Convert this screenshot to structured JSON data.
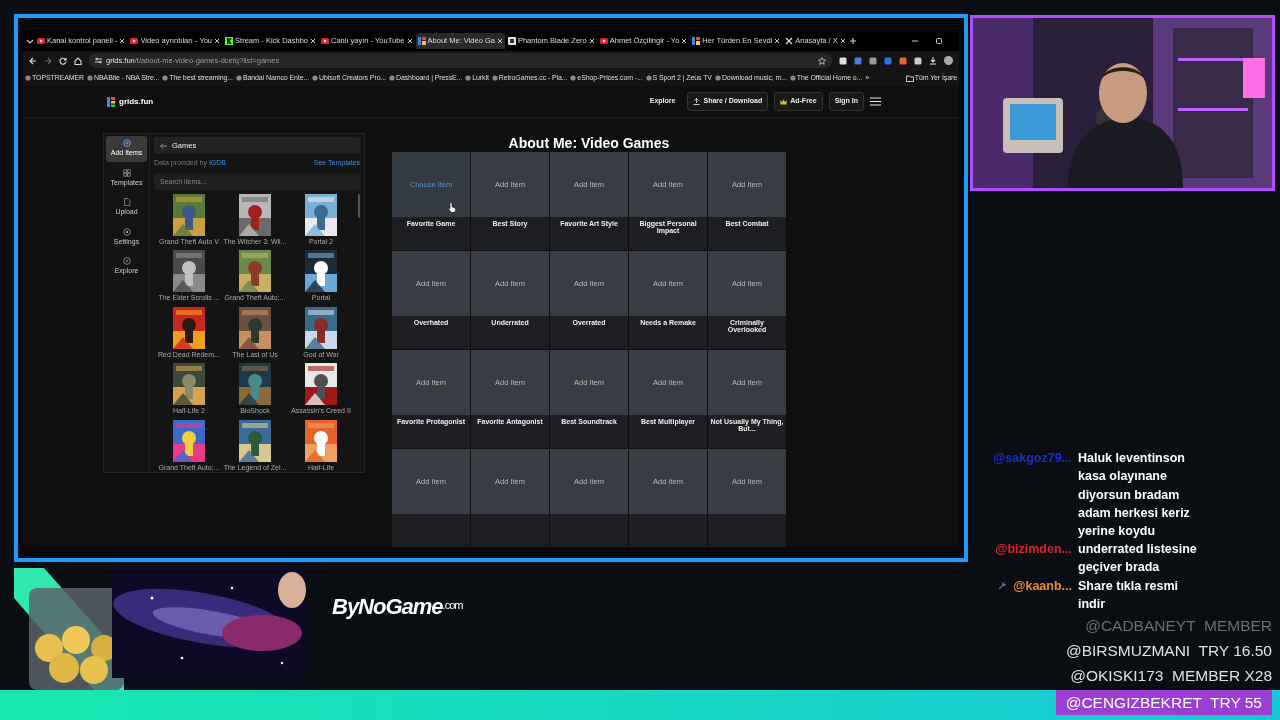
{
  "browser": {
    "tabs": [
      {
        "kind": "video",
        "title": "Kanal kontrol paneli -",
        "selected": false
      },
      {
        "kind": "video",
        "title": "Video ayrıntıları - You",
        "selected": false
      },
      {
        "kind": "stream",
        "title": "Stream - Kick Dashbo",
        "selected": false
      },
      {
        "kind": "video",
        "title": "Canlı yayın - YouTube",
        "selected": false
      },
      {
        "kind": "grid",
        "title": "About Me: Video Ga",
        "selected": true
      },
      {
        "kind": "store",
        "title": "Phantom Blade Zero",
        "selected": false
      },
      {
        "kind": "video",
        "title": "Ahmet Özçilingir - Yo",
        "selected": false
      },
      {
        "kind": "grid",
        "title": "Her Türden En Sevdi",
        "selected": false
      },
      {
        "kind": "social",
        "title": "Anasayfa / X",
        "selected": false
      }
    ],
    "address": {
      "host": "grids.fun",
      "path": "/t/about-me-video-games-dcefq?list=games"
    },
    "bookmarks": [
      "TOPSTREAMER",
      "NBABite - NBA Stre...",
      "The best streaming...",
      "Bandai Namco Ente...",
      "Ubisoft Creators Pro...",
      "Dashboard | PressE...",
      "Lurkit",
      "RetroGames.cc - Pla...",
      "eShop-Prices.com -...",
      "S Sport 2 | Zeus TV",
      "Download music, m...",
      "The Official Home o..."
    ],
    "bookmarks_more": "»",
    "bookmarks_folder": "Tüm Yer İşare"
  },
  "site": {
    "logo": "grids.fun",
    "nav": [
      {
        "kind": "link",
        "label": "Explore"
      },
      {
        "kind": "share",
        "label": "Share / Download"
      },
      {
        "kind": "premium",
        "label": "Ad-Free"
      },
      {
        "kind": "button",
        "label": "Sign In"
      }
    ],
    "sidebar": [
      {
        "kind": "add",
        "label": "Add Items",
        "selected": true
      },
      {
        "kind": "templates",
        "label": "Templates",
        "selected": false
      },
      {
        "kind": "upload",
        "label": "Upload",
        "selected": false
      },
      {
        "kind": "settings",
        "label": "Settings",
        "selected": false
      },
      {
        "kind": "explore",
        "label": "Explore",
        "selected": false
      }
    ],
    "panel": {
      "title": "Games",
      "credit": "Data provided by ",
      "credit_link": "IGDB",
      "templates_link": "See Templates",
      "search": {
        "placeholder": "Search items..."
      },
      "games": [
        "Grand Theft Auto V",
        "The Witcher 3: Wil...",
        "Portal 2",
        "The Elder Scrolls ...",
        "Grand Theft Auto:...",
        "Portal",
        "Red Dead Redem...",
        "The Last of Us",
        "God of War",
        "Half-Life 2",
        "BioShock",
        "Assassin's Creed II",
        "Grand Theft Auto:...",
        "The Legend of Zel...",
        "Half-Life"
      ]
    },
    "grid": {
      "title": "About Me: Video Games",
      "cells": [
        {
          "prompt": "Choose Item",
          "label": "Favorite Game",
          "hovered": true
        },
        {
          "prompt": "Add Item",
          "label": "Best Story",
          "hovered": false
        },
        {
          "prompt": "Add Item",
          "label": "Favorite Art Style",
          "hovered": false
        },
        {
          "prompt": "Add Item",
          "label": "Biggest Personal Impact",
          "hovered": false
        },
        {
          "prompt": "Add Item",
          "label": "Best Combat",
          "hovered": false
        },
        {
          "prompt": "Add Item",
          "label": "Overhated",
          "hovered": false
        },
        {
          "prompt": "Add Item",
          "label": "Underrated",
          "hovered": false
        },
        {
          "prompt": "Add Item",
          "label": "Overrated",
          "hovered": false
        },
        {
          "prompt": "Add Item",
          "label": "Needs a Remake",
          "hovered": false
        },
        {
          "prompt": "Add Item",
          "label": "Criminally Overlooked",
          "hovered": false
        },
        {
          "prompt": "Add Item",
          "label": "Favorite Protagonist",
          "hovered": false
        },
        {
          "prompt": "Add Item",
          "label": "Favorite Antagonist",
          "hovered": false
        },
        {
          "prompt": "Add Item",
          "label": "Best Soundtrack",
          "hovered": false
        },
        {
          "prompt": "Add Item",
          "label": "Best Multiplayer",
          "hovered": false
        },
        {
          "prompt": "Add Item",
          "label": "Not Usually My Thing, But...",
          "hovered": false
        },
        {
          "prompt": "Add Item",
          "hovered": false
        },
        {
          "prompt": "Add Item",
          "hovered": false
        },
        {
          "prompt": "Add Item",
          "hovered": false
        },
        {
          "prompt": "Add Item",
          "hovered": false
        },
        {
          "prompt": "Add Item",
          "hovered": false
        }
      ]
    }
  },
  "overlay": {
    "logo": "ByNoGame",
    "logo_suffix": ".com",
    "chat": [
      {
        "user": "@sakgoz79...",
        "color": "#1a2fc8",
        "moderator": false,
        "text": "Haluk leventinson kasa olayınane diyorsun bradam adam herkesi keriz yerine koydu"
      },
      {
        "user": "@bizimden...",
        "color": "#e0202a",
        "moderator": false,
        "text": "underrated listesine geçiver brada"
      },
      {
        "user": "@kaanb...",
        "color": "#f08a30",
        "moderator": true,
        "text": "Share tıkla resmi indir"
      }
    ],
    "alerts": [
      {
        "kind": "faded",
        "user": "@CADBANEYT",
        "event": "MEMBER"
      },
      {
        "kind": "plain",
        "user": "@BIRSMUZMANI",
        "event": "TRY 16.50"
      },
      {
        "kind": "plain",
        "user": "@OKISKI173",
        "event": "MEMBER X28"
      },
      {
        "kind": "highlight",
        "user": "@CENGIZBEKRET",
        "event": "TRY 55"
      }
    ]
  }
}
